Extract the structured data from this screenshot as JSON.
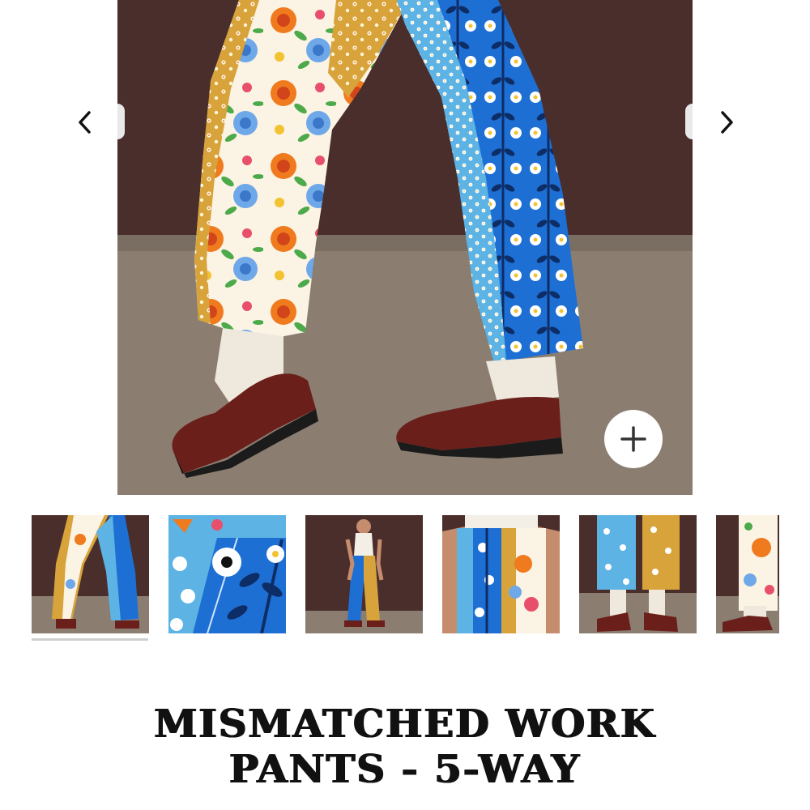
{
  "gallery": {
    "main_image_alt": "",
    "prev_icon": "chevron-left-icon",
    "next_icon": "chevron-right-icon",
    "zoom_icon": "plus-icon",
    "selected_thumbnail_index": 0,
    "thumbnail_count_visible": 6
  },
  "product": {
    "title_line1": "MISMATCHED WORK",
    "title_line2": "PANTS - 5-WAY"
  },
  "colors": {
    "backdrop": "#4a2e2b",
    "floor": "#8c7f72",
    "gold_print": "#d9a63a",
    "blue_print": "#1f6fd0",
    "light_blue_print": "#5bb4e6",
    "shoe": "#6b1f1a",
    "indicator": "#cfcfcf"
  }
}
